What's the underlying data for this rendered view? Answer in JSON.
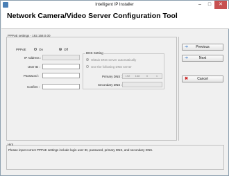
{
  "window": {
    "title": "Intelligent IP Installer"
  },
  "header": {
    "title": "Network Camera/Video Server Configuration Tool"
  },
  "section": {
    "label": "PPPoE settings - 192.168.0.00"
  },
  "pppoe": {
    "label": "PPPoE",
    "on_label": "On",
    "off_label": "Off",
    "selected": "Off"
  },
  "fields": {
    "ip_address_label": "IP Address :",
    "user_id_label": "User ID :",
    "password_label": "Password :",
    "confirm_label": "Confirm :"
  },
  "dns": {
    "group_title": "DNS Setting",
    "auto_label": "Obtain DNS server automatically",
    "manual_label": "Use the following DNS server",
    "primary_label": "Primary DNS :",
    "primary_value": [
      "192",
      "168",
      "0",
      "1"
    ],
    "secondary_label": "Secondary DNS :"
  },
  "buttons": {
    "previous": "Previous",
    "next": "Next",
    "cancel": "Cancel"
  },
  "hint": {
    "label": "Hint",
    "text": "Please input correct PPPoE settings include login user ID, password, primary DNS, and secondary DNS."
  }
}
